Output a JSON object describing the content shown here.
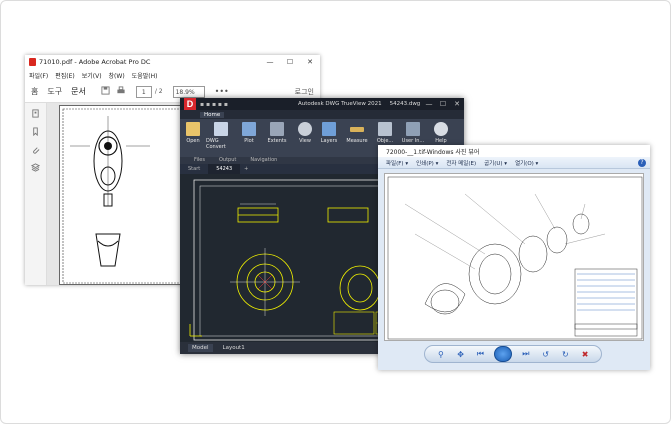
{
  "acrobat": {
    "title": "71010.pdf - Adobe Acrobat Pro DC",
    "menu": [
      "파일(F)",
      "편집(E)",
      "보기(V)",
      "창(W)",
      "도움말(H)"
    ],
    "tabs": [
      "홈",
      "도구",
      "문서"
    ],
    "page_current": "1",
    "page_total": "/ 2",
    "zoom": "18.9%",
    "more": "•••",
    "login": "로그인",
    "colors": {
      "pdf_icon": "#d9281f"
    }
  },
  "dwg": {
    "logo": "D",
    "app_name": "Autodesk DWG TrueView 2021",
    "file_name": "54243.dwg",
    "ribbon_tab": "Home",
    "ribbon_buttons": [
      "Open",
      "DWG Convert",
      "Plot",
      "Extents",
      "View",
      "Layers",
      "Measure",
      "Obje...",
      "User In...",
      "Help"
    ],
    "panels": [
      "Files",
      "Output",
      "Navigation"
    ],
    "doc_tabs": [
      "Start",
      "54243"
    ],
    "layout_tabs": [
      "Model",
      "Layout1"
    ],
    "colors": {
      "logo_bg": "#d8262c",
      "canvas": "#212830"
    }
  },
  "photo_viewer": {
    "title": "72000-__1.tif-Windows 사진 뷰어",
    "menu": [
      "파일(F) ▾",
      "인쇄(P) ▾",
      "전자 메일(E)",
      "굽기(U) ▾",
      "열기(O) ▾"
    ],
    "help": "?",
    "toolbar_icons": [
      "zoom-icon",
      "actual-size-icon",
      "previous-icon",
      "slideshow-icon",
      "next-icon",
      "rotate-left-icon",
      "rotate-right-icon",
      "delete-icon"
    ],
    "colors": {
      "accent": "#2a5fb8",
      "delete": "#c0282c"
    }
  }
}
